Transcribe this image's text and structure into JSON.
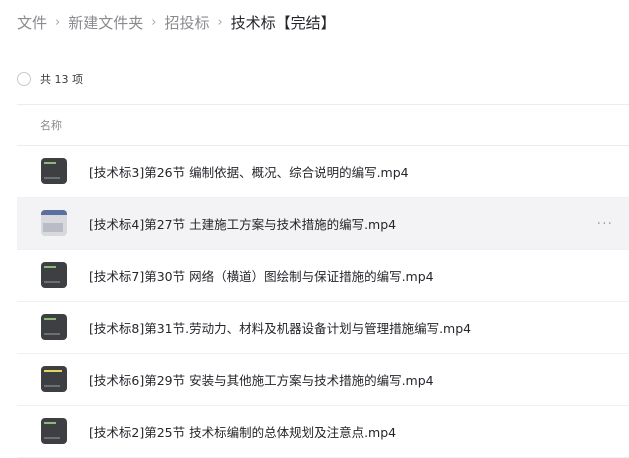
{
  "breadcrumb": {
    "items": [
      "文件",
      "新建文件夹",
      "招投标"
    ],
    "current": "技术标【完结】",
    "separator": "›"
  },
  "summary": {
    "count_text": "共 13 项"
  },
  "columns": {
    "name": "名称"
  },
  "files": [
    {
      "name": "[技术标3]第26节 编制依据、概况、综合说明的编写.mp4",
      "thumb": "video-thumbnail"
    },
    {
      "name": "[技术标4]第27节 土建施工方案与技术措施的编写.mp4",
      "thumb": "video-thumbnail",
      "hovered": true,
      "more": "···"
    },
    {
      "name": "[技术标7]第30节 网络（横道）图绘制与保证措施的编写.mp4",
      "thumb": "video-thumbnail"
    },
    {
      "name": "[技术标8]第31节.劳动力、材料及机器设备计划与管理措施编写.mp4",
      "thumb": "video-thumbnail"
    },
    {
      "name": "[技术标6]第29节 安装与其他施工方案与技术措施的编写.mp4",
      "thumb": "video-thumbnail"
    },
    {
      "name": "[技术标2]第25节 技术标编制的总体规划及注意点.mp4",
      "thumb": "video-thumbnail"
    }
  ],
  "colors": {
    "hover_row": "#f3f3f5",
    "muted_text": "#8a8a8f",
    "primary_text": "#25262b"
  }
}
